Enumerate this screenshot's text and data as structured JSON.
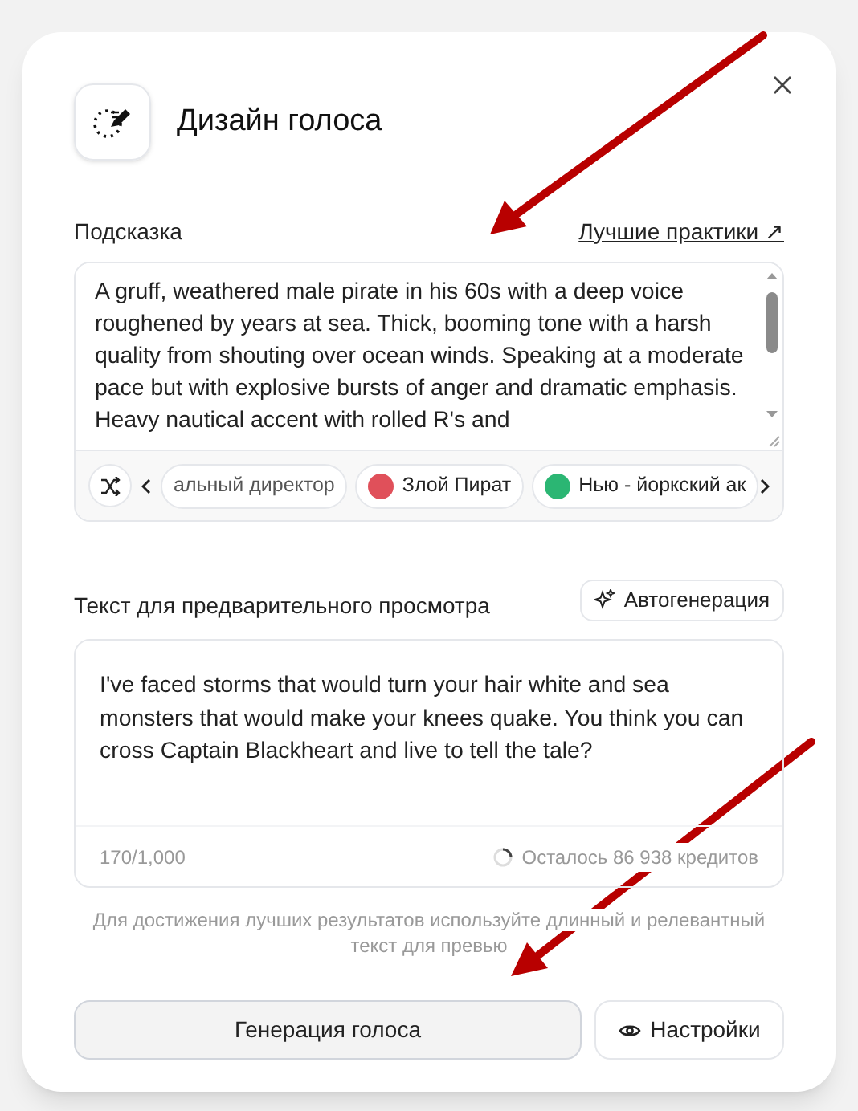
{
  "dialog": {
    "title": "Дизайн голоса"
  },
  "prompt": {
    "label": "Подсказка",
    "link": "Лучшие практики",
    "link_icon": "↗",
    "value": "A gruff, weathered male pirate in his 60s with a deep voice roughened by years at sea. Thick, booming tone with a harsh quality from shouting over ocean winds. Speaking at a moderate pace but with explosive bursts of anger and dramatic emphasis. Heavy nautical accent with rolled R's and"
  },
  "voice_chips": [
    {
      "label": "альный директор"
    },
    {
      "label": "Злой Пират",
      "color": "#e0505a"
    },
    {
      "label": "Нью - йоркский ак",
      "color": "#2bb673"
    }
  ],
  "preview": {
    "label": "Текст для предварительного просмотра",
    "autogen_button": "Автогенерация",
    "value": "I've faced storms that would turn your hair white and sea monsters that would make your knees quake. You think you can cross Captain Blackheart and live to tell the tale?",
    "count": "170/1,000",
    "credits": "Осталось 86 938 кредитов"
  },
  "hint": "Для достижения лучших результатов используйте длинный и релевантный текст для превью",
  "buttons": [
    {
      "kind": "primary",
      "label": "Генерация голоса"
    },
    {
      "kind": "secondary",
      "label": "Настройки"
    }
  ]
}
